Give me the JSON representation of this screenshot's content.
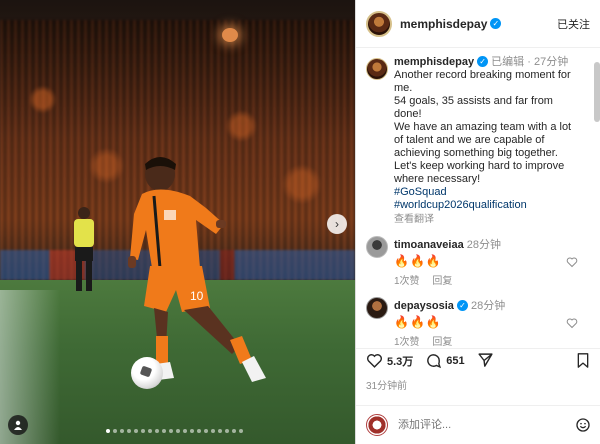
{
  "post": {
    "username": "memphisdepay",
    "follow_label": "已关注",
    "carousel_dots": 20,
    "active_dot": 0
  },
  "caption": {
    "username": "memphisdepay",
    "edited_label": "已编辑",
    "age": "27分钟",
    "lines": [
      "Another record breaking moment for me.",
      "54 goals, 35 assists and far from done!",
      "We have an amazing team with a lot of talent and we are capable of achieving something big together.",
      "Let's keep working hard to improve where necessary!"
    ],
    "hashtags": [
      "#GoSquad",
      "#worldcup2026qualification"
    ],
    "translate_label": "查看翻译"
  },
  "comments": [
    {
      "username": "timoanaveiaa",
      "age": "28分钟",
      "text": "🔥🔥🔥",
      "likes": "1次赞",
      "reply": "回复"
    },
    {
      "username": "depaysosia",
      "age": "28分钟",
      "text": "🔥🔥🔥",
      "likes": "1次赞",
      "reply": "回复"
    }
  ],
  "stats": {
    "likes": "5.3万",
    "comments": "651"
  },
  "timestamp": "31分钟前",
  "add_comment": {
    "placeholder": "添加评论..."
  },
  "colors": {
    "verified": "#0095f6",
    "jersey": "#f07a1a",
    "link": "#00376b"
  }
}
